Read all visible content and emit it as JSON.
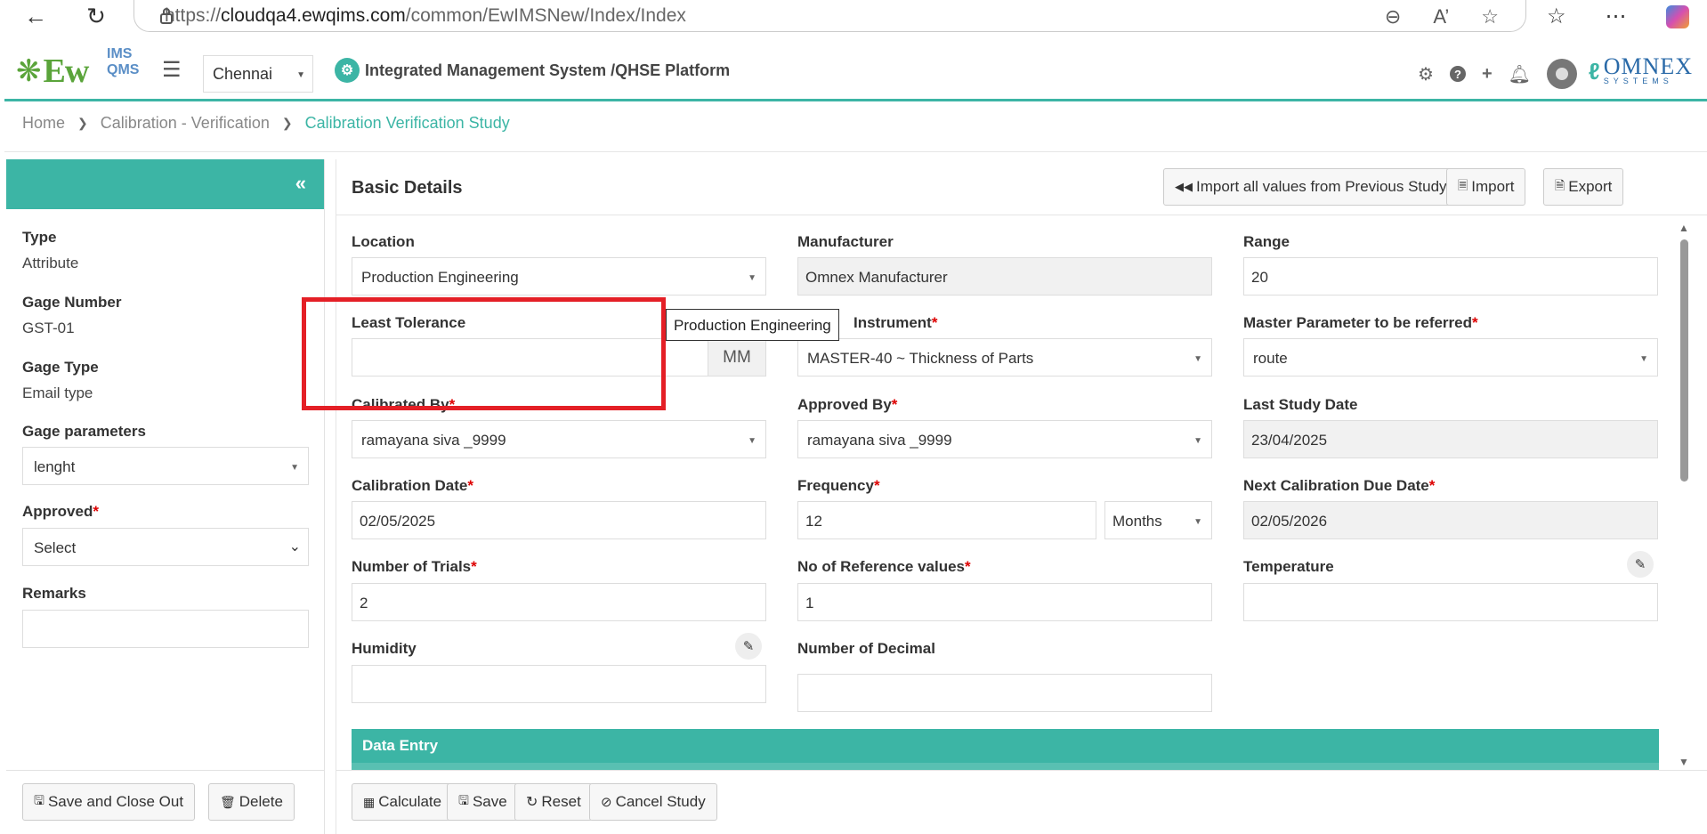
{
  "browser": {
    "url_prefix": "https://",
    "url_host": "cloudqa4.ewqims.com",
    "url_path": "/common/EwIMSNew/Index/Index"
  },
  "header": {
    "logo_text": "Ew",
    "logo_sub": "IMS QMS",
    "site": "Chennai",
    "platform": "Integrated Management System /QHSE Platform",
    "company_logo": "OMNEX",
    "company_sub": "SYSTEMS"
  },
  "breadcrumb": {
    "home": "Home",
    "section": "Calibration - Verification",
    "current": "Calibration Verification Study"
  },
  "left": {
    "type_label": "Type",
    "type_value": "Attribute",
    "gage_number_label": "Gage Number",
    "gage_number_value": "GST-01",
    "gage_type_label": "Gage Type",
    "gage_type_value": "Email type",
    "gage_params_label": "Gage parameters",
    "gage_params_value": "lenght",
    "approved_label": "Approved",
    "approved_value": "Select",
    "remarks_label": "Remarks",
    "save_close_button": "Save and Close Out",
    "delete_button": "Delete"
  },
  "main": {
    "title": "Basic Details",
    "import_prev_button": "Import all values from Previous Study",
    "import_button": "Import",
    "export_button": "Export",
    "fields": {
      "location_label": "Location",
      "location_value": "Production Engineering",
      "manufacturer_label": "Manufacturer",
      "manufacturer_value": "Omnex Manufacturer",
      "range_label": "Range",
      "range_value": "20",
      "least_tolerance_label": "Least Tolerance",
      "least_tolerance_unit": "MM",
      "instrument_label": "Instrument",
      "instrument_value": "MASTER-40 ~ Thickness of Parts",
      "master_param_label": "Master Parameter to be referred",
      "master_param_value": "route",
      "calibrated_by_label": "Calibrated By",
      "calibrated_by_value": "ramayana siva _9999",
      "approved_by_label": "Approved By",
      "approved_by_value": "ramayana siva _9999",
      "last_study_label": "Last Study Date",
      "last_study_value": "23/04/2025",
      "calibration_date_label": "Calibration Date",
      "calibration_date_value": "02/05/2025",
      "frequency_label": "Frequency",
      "frequency_value": "12",
      "frequency_unit": "Months",
      "next_due_label": "Next Calibration Due Date",
      "next_due_value": "02/05/2026",
      "trials_label": "Number of Trials",
      "trials_value": "2",
      "ref_values_label": "No of Reference values",
      "ref_values_value": "1",
      "temperature_label": "Temperature",
      "humidity_label": "Humidity",
      "decimal_label": "Number of Decimal"
    },
    "data_entry_title": "Data Entry",
    "calculate_button": "Calculate",
    "save_button": "Save",
    "reset_button": "Reset",
    "cancel_button": "Cancel Study"
  },
  "tooltip": "Production Engineering",
  "colors": {
    "accent": "#3cb5a5",
    "highlight": "#e41f26",
    "required": "#dd0000"
  }
}
